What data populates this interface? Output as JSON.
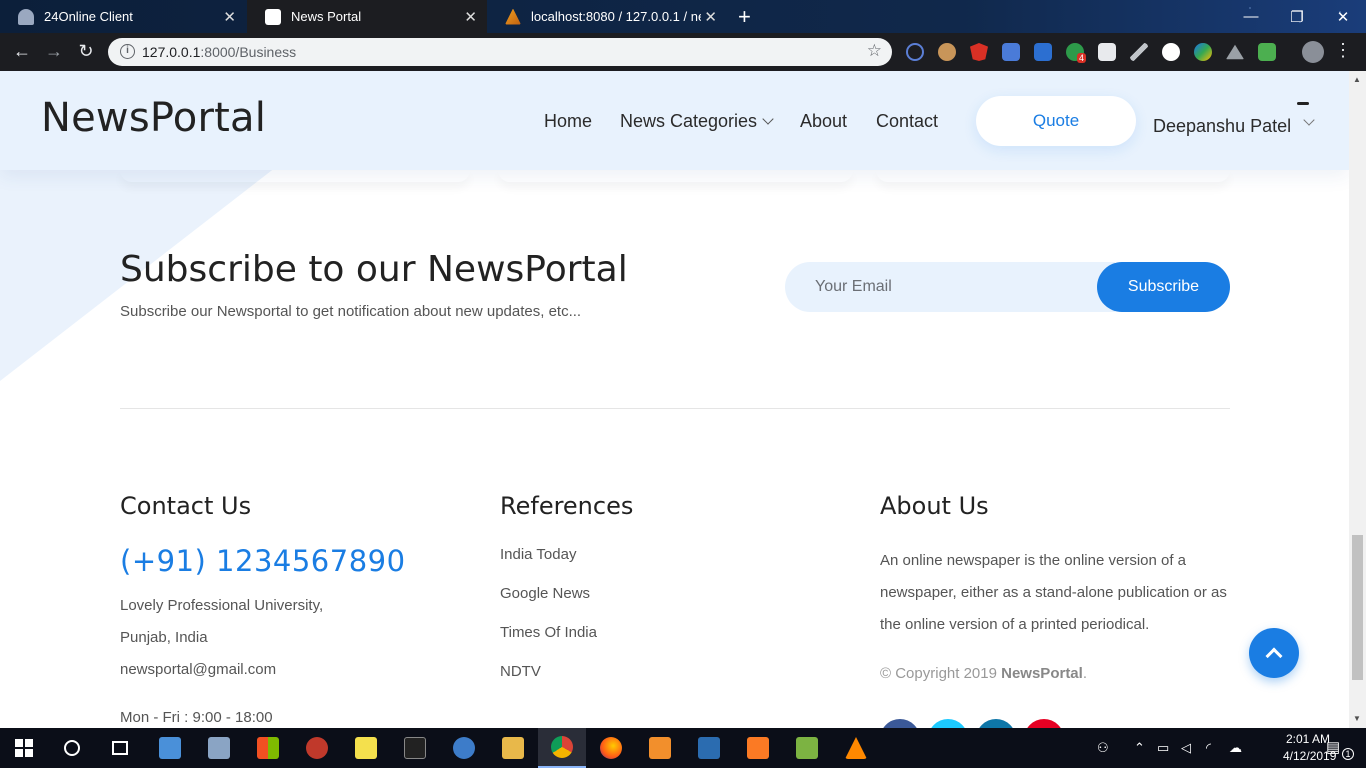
{
  "browser": {
    "tabs": [
      {
        "title": "24Online Client",
        "active": false
      },
      {
        "title": "News Portal",
        "active": true
      },
      {
        "title": "localhost:8080 / 127.0.0.1 / newsp",
        "active": false
      }
    ],
    "url_host": "127.0.0.1",
    "url_rest": ":8000/Business",
    "extension_badge": "4"
  },
  "site": {
    "logo": "NewsPortal",
    "nav": {
      "home": "Home",
      "categories": "News Categories",
      "about": "About",
      "contact": "Contact",
      "quote": "Quote",
      "user": "Deepanshu Patel"
    },
    "subscribe": {
      "title": "Subscribe to our NewsPortal",
      "text": "Subscribe our Newsportal to get notification about new updates, etc...",
      "placeholder": "Your Email",
      "button": "Subscribe"
    },
    "footer": {
      "contact": {
        "title": "Contact Us",
        "phone": "(+91) 1234567890",
        "address1": "Lovely Professional University,",
        "address2": "Punjab, India",
        "email": "newsportal@gmail.com",
        "hours": "Mon - Fri : 9:00 - 18:00"
      },
      "references": {
        "title": "References",
        "links": [
          "India Today",
          "Google News",
          "Times Of India",
          "NDTV"
        ]
      },
      "about": {
        "title": "About Us",
        "text": "An online newspaper is the online version of a newspaper, either as a stand-alone publication or as the online version of a printed periodical.",
        "copyright_prefix": "© Copyright 2019 ",
        "copyright_brand": "NewsPortal",
        "copyright_suffix": "."
      }
    }
  },
  "taskbar": {
    "time": "2:01 AM",
    "date": "4/12/2019",
    "notification_count": "1"
  },
  "colors": {
    "accent": "#1a7de3",
    "header_bg": "#e8f2fd",
    "tabbar_bg": "#0b2242"
  }
}
